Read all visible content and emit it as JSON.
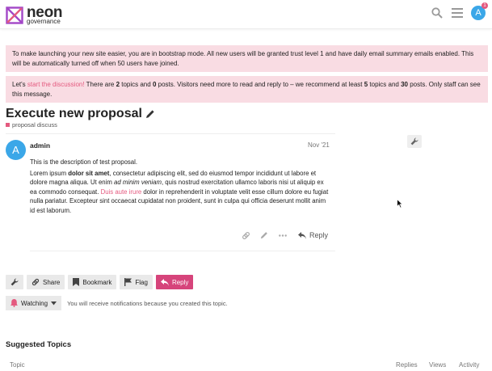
{
  "header": {
    "logo_main": "neon",
    "logo_sub": "governance",
    "icons": [
      "search-icon",
      "hamburger-icon",
      "user-avatar"
    ],
    "avatar_letter": "A",
    "notification_count": "1"
  },
  "banners": {
    "bootstrap": "To make launching your new site easier, you are in bootstrap mode. All new users will be granted trust level 1 and have daily email summary emails enabled. This will be automatically turned off when 50 users have joined.",
    "discussion": {
      "prefix": "Let's ",
      "link": "start the discussion!",
      "p1": " There are ",
      "topics": "2",
      "p2": " topics and ",
      "posts": "0",
      "p3": " posts. Visitors need more to read and reply to – we recommend at least ",
      "rec_topics": "5",
      "p4": " topics and ",
      "rec_posts": "30",
      "p5": " posts. Only staff can see this message."
    }
  },
  "topic": {
    "title": "Execute new proposal",
    "category": "proposal discuss"
  },
  "post": {
    "avatar_letter": "A",
    "username": "admin",
    "date": "Nov '21",
    "line1": "This is the description of test proposal.",
    "b1": "Lorem ipsum ",
    "b1_bold": "dolor sit amet",
    "b2": ", consectetur adipiscing elit, sed do eiusmod tempor incididunt ut labore et dolore magna aliqua. Ut enim ",
    "b2_italic": "ad minim veniam",
    "b3": ", quis nostrud exercitation ullamco laboris nisi ut aliquip ex ea commodo consequat. ",
    "b3_link": "Duis aute irure",
    "b4": " dolor in reprehenderit in voluptate velit esse cillum dolore eu fugiat nulla pariatur. Excepteur sint occaecat cupidatat non proident, sunt in culpa qui officia deserunt mollit anim id est laborum.",
    "reply_label": "Reply"
  },
  "footer_buttons": {
    "share": "Share",
    "bookmark": "Bookmark",
    "flag": "Flag",
    "reply": "Reply"
  },
  "notifications": {
    "level": "Watching",
    "note": "You will receive notifications because you created this topic."
  },
  "suggested": {
    "title": "Suggested Topics",
    "columns": [
      "Topic",
      "Replies",
      "Views",
      "Activity"
    ]
  },
  "colors": {
    "accent": "#e45a7f",
    "reply_button": "#d6447b",
    "banner_bg": "#f9dce3",
    "avatar": "#3ba7e8"
  }
}
